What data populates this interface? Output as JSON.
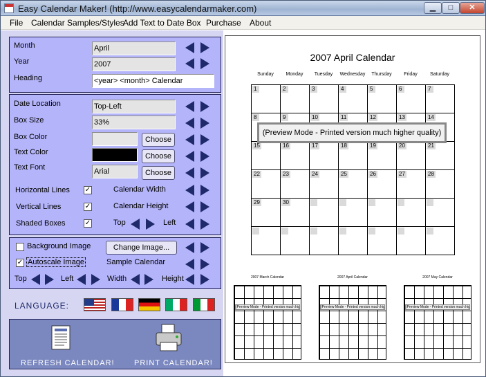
{
  "window": {
    "title": "Easy Calendar Maker! (http://www.easycalendarmaker.com)",
    "min": "▁",
    "max": "□",
    "close": "✕"
  },
  "menu": [
    "File",
    "Calendar Samples/Styles",
    "Add Text to Date Box",
    "Purchase",
    "About"
  ],
  "date_panel": {
    "month_label": "Month",
    "month_value": "April",
    "year_label": "Year",
    "year_value": "2007",
    "heading_label": "Heading",
    "heading_value": "<year> <month> Calendar"
  },
  "box_panel": {
    "date_location_label": "Date Location",
    "date_location_value": "Top-Left",
    "box_size_label": "Box Size",
    "box_size_value": "33%",
    "box_color_label": "Box Color",
    "text_color_label": "Text Color",
    "text_font_label": "Text Font",
    "text_font_value": "Arial",
    "choose_label": "Choose",
    "box_color": "#e6e6e6",
    "text_color": "#000000",
    "horizontal_lines": "Horizontal Lines",
    "vertical_lines": "Vertical Lines",
    "shaded_boxes": "Shaded Boxes",
    "calendar_width": "Calendar Width",
    "calendar_height": "Calendar Height",
    "top": "Top",
    "left": "Left"
  },
  "bg_panel": {
    "background_image": "Background Image",
    "change_image": "Change Image...",
    "autoscale_image": "Autoscale Image",
    "sample_calendar": "Sample Calendar",
    "top": "Top",
    "left": "Left",
    "width": "Width",
    "height": "Height"
  },
  "language": {
    "label": "LANGUAGE:"
  },
  "actions": {
    "refresh": "REFRESH CALENDAR!",
    "print": "PRINT CALENDAR!"
  },
  "calendar": {
    "title": "2007 April Calendar",
    "days": [
      "Sunday",
      "Monday",
      "Tuesday",
      "Wednesday",
      "Thursday",
      "Friday",
      "Saturday"
    ],
    "preview_notice": "(Preview Mode - Printed version much higher quality)",
    "weeks": [
      [
        "1",
        "2",
        "3",
        "4",
        "5",
        "6",
        "7"
      ],
      [
        "8",
        "9",
        "10",
        "11",
        "12",
        "13",
        "14"
      ],
      [
        "15",
        "16",
        "17",
        "18",
        "19",
        "20",
        "21"
      ],
      [
        "22",
        "23",
        "24",
        "25",
        "26",
        "27",
        "28"
      ],
      [
        "29",
        "30",
        "",
        "",
        "",
        "",
        ""
      ],
      [
        "",
        "",
        "",
        "",
        "",
        "",
        ""
      ]
    ]
  },
  "minis": [
    {
      "title": "2007 March Calendar",
      "notice": "(Preview Mode - Printed version much higher quality)"
    },
    {
      "title": "2007 April Calendar",
      "notice": "(Preview Mode - Printed version much higher quality)"
    },
    {
      "title": "2007 May Calendar",
      "notice": "(Preview Mode - Printed version much higher quality)"
    }
  ]
}
